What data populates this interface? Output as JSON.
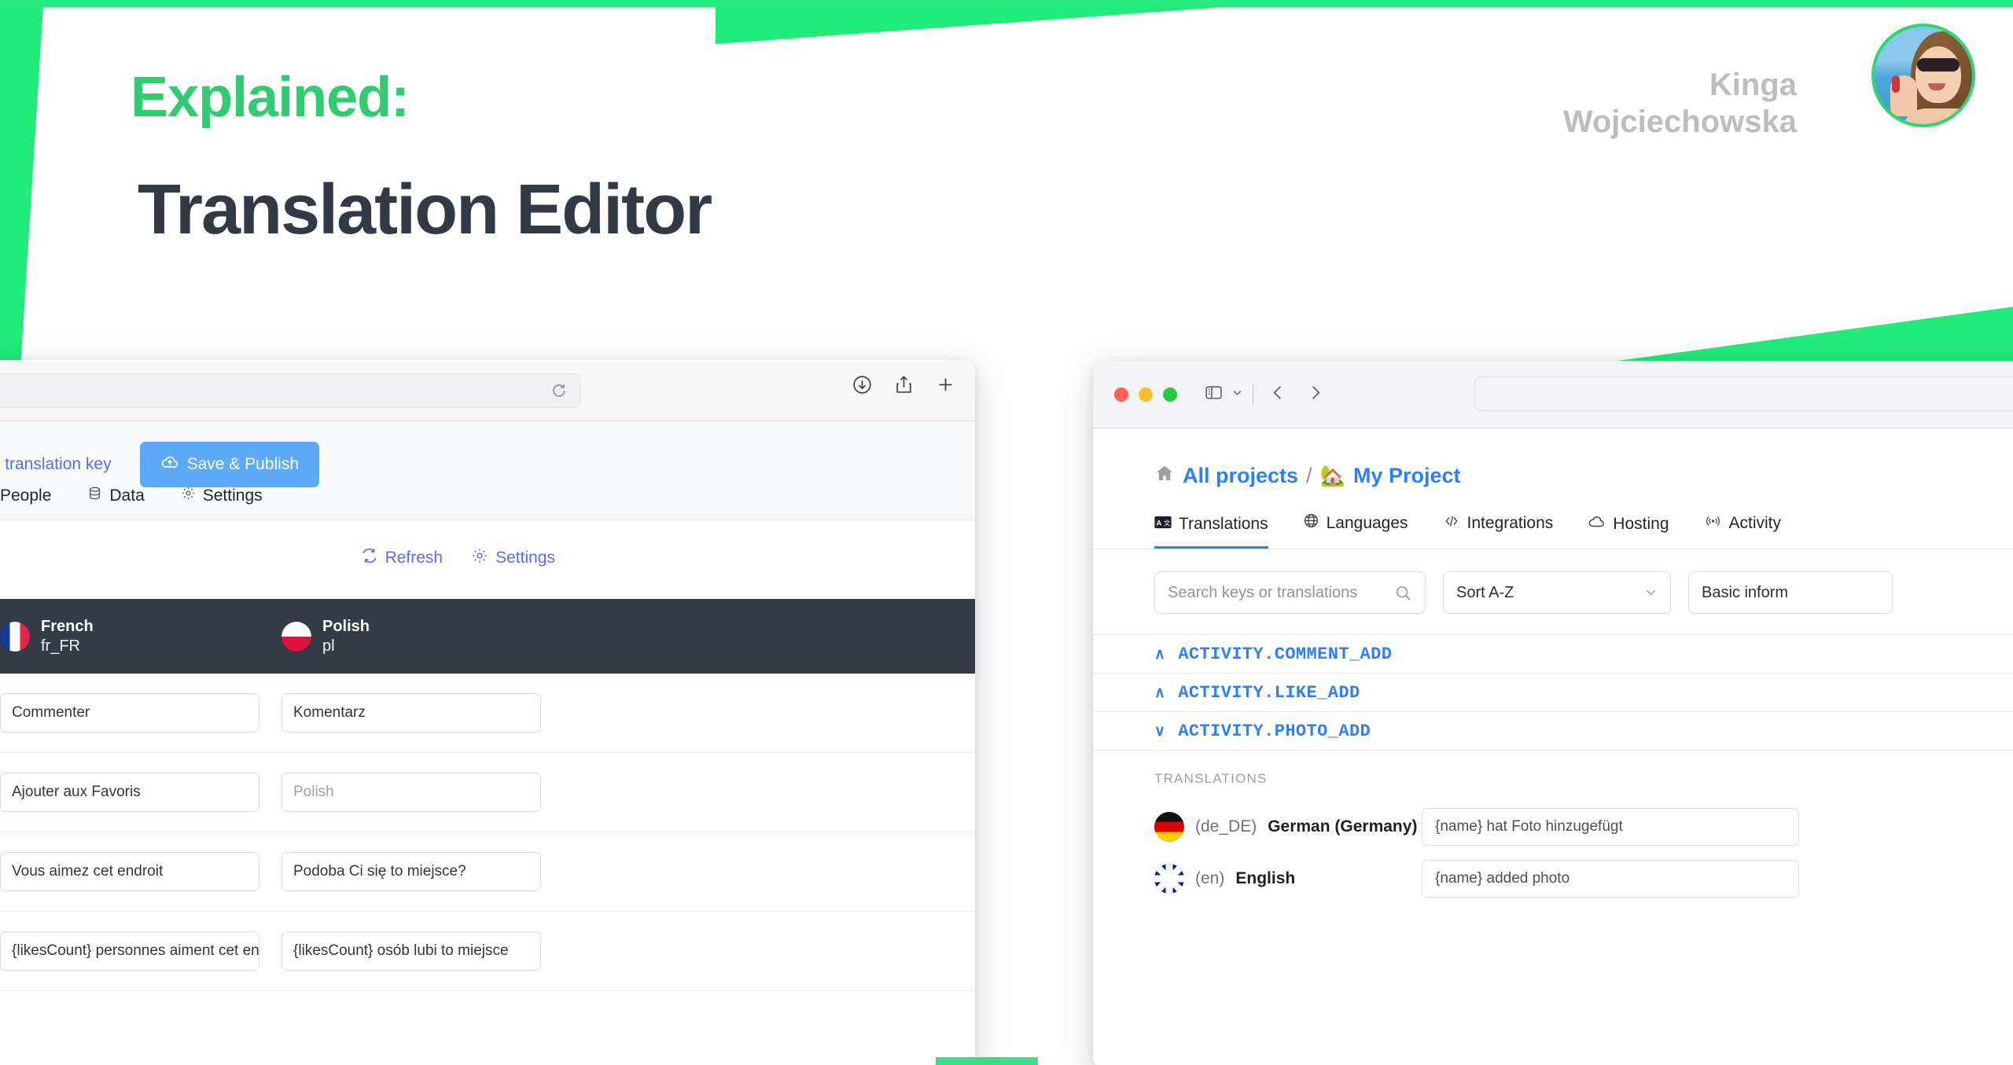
{
  "banner": {
    "eyebrow": "Explained:",
    "title": "Translation Editor",
    "author_first": "Kinga",
    "author_last": "Wojciechowska",
    "accent_green": "#22eb7a",
    "title_color": "#333a45",
    "eyebrow_color": "#32cb72"
  },
  "left_window": {
    "toolbar": {
      "url_value": "",
      "reload_icon": "reload-icon",
      "downloads_icon": "downloads-icon",
      "share_icon": "share-icon",
      "newtab_icon": "plus-icon"
    },
    "appbar": {
      "add_key_label": "Add translation key",
      "add_key_plus": "+",
      "save_label": "Save & Publish",
      "save_icon": "cloud-upload-icon",
      "save_bg": "#5daafb",
      "link_color": "#5b6bf0"
    },
    "tabs": [
      {
        "label": "People",
        "icon": ""
      },
      {
        "label": "Data",
        "icon": "database-icon"
      },
      {
        "label": "Settings",
        "icon": "gear-icon"
      }
    ],
    "subactions": [
      {
        "label": "Refresh",
        "icon": "refresh-icon"
      },
      {
        "label": "Settings",
        "icon": "gear-icon"
      }
    ],
    "table": {
      "header_bg": "#343a46",
      "columns": [
        {
          "flag": "flag-fr",
          "language": "French",
          "code": "fr_FR"
        },
        {
          "flag": "flag-pl",
          "language": "Polish",
          "code": "pl"
        }
      ],
      "rows": [
        {
          "fr": "Commenter",
          "fr_placeholder": false,
          "pl": "Komentarz",
          "pl_placeholder": false
        },
        {
          "fr": "Ajouter aux Favoris",
          "fr_placeholder": false,
          "pl": "Polish",
          "pl_placeholder": true
        },
        {
          "fr": "Vous aimez cet endroit",
          "fr_placeholder": false,
          "pl": "Podoba Ci się to miejsce?",
          "pl_placeholder": false
        },
        {
          "fr": "{likesCount} personnes aiment cet endroit",
          "fr_placeholder": false,
          "pl": "{likesCount} osób lubi to miejsce",
          "pl_placeholder": false
        }
      ]
    }
  },
  "right_window": {
    "toolbar": {
      "url_value": "",
      "sidebar_icon": "sidebar-icon",
      "chevron_icon": "chevron-down-icon",
      "back_icon": "chevron-left-icon",
      "forward_icon": "chevron-right-icon",
      "traffic_red": "#ff5f57",
      "traffic_yellow": "#febc2e",
      "traffic_green": "#28c840"
    },
    "breadcrumb": {
      "home_icon": "home-icon",
      "all_projects": "All projects",
      "separator": "/",
      "project_icon": "house-with-garden-emoji",
      "project_name": "My Project",
      "link_color": "#2d7ff9"
    },
    "tabs": [
      {
        "label": "Translations",
        "icon": "translate-icon",
        "active": true
      },
      {
        "label": "Languages",
        "icon": "globe-icon",
        "active": false
      },
      {
        "label": "Integrations",
        "icon": "code-icon",
        "active": false
      },
      {
        "label": "Hosting",
        "icon": "cloud-icon",
        "active": false
      },
      {
        "label": "Activity",
        "icon": "broadcast-icon",
        "active": false
      }
    ],
    "filters": {
      "search_placeholder": "Search keys or translations",
      "search_value": "",
      "search_icon": "search-icon",
      "sort_value": "Sort A-Z",
      "sort_chevron": "chevron-down-icon",
      "info_value": "Basic inform"
    },
    "keys": [
      {
        "name": "ACTIVITY.COMMENT_ADD",
        "caret": "∧",
        "expanded": false
      },
      {
        "name": "ACTIVITY.LIKE_ADD",
        "caret": "∧",
        "expanded": false
      },
      {
        "name": "ACTIVITY.PHOTO_ADD",
        "caret": "∨",
        "expanded": true
      }
    ],
    "expanded_key": {
      "section_label": "TRANSLATIONS",
      "translations": [
        {
          "flag": "flag-de",
          "code": "(de_DE)",
          "name": "German (Germany)",
          "value": "{name} hat Foto hinzugefügt"
        },
        {
          "flag": "flag-gb",
          "code": "(en)",
          "name": "English",
          "value": "{name} added photo"
        }
      ]
    }
  }
}
